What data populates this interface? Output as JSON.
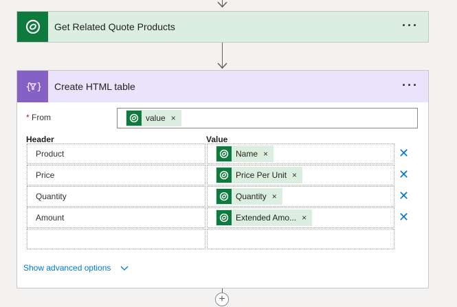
{
  "steps": [
    {
      "title": "Get Related Quote Products",
      "menu_label": "···"
    },
    {
      "title": "Create HTML table",
      "menu_label": "···"
    }
  ],
  "html_table": {
    "from": {
      "required_mark": "*",
      "label": "From",
      "token": "value"
    },
    "columns": {
      "header": "Header",
      "value": "Value"
    },
    "rows": [
      {
        "header": "Product",
        "value_token": "Name"
      },
      {
        "header": "Price",
        "value_token": "Price Per Unit"
      },
      {
        "header": "Quantity",
        "value_token": "Quantity"
      },
      {
        "header": "Amount",
        "value_token": "Extended Amo..."
      }
    ],
    "advanced_label": "Show advanced options"
  },
  "icons": {
    "dataverse": "dataverse-icon",
    "data_operation": "data-operation-icon",
    "close": "close-icon",
    "chevron": "chevron-down-icon",
    "add": "add-step-icon"
  },
  "colors": {
    "dataverse_green": "#0f7a3d",
    "token_bg": "#dbeedf",
    "data_op_purple": "#8661c5",
    "data_op_header_bg": "#ebe3fb",
    "link_blue": "#0078d4"
  }
}
